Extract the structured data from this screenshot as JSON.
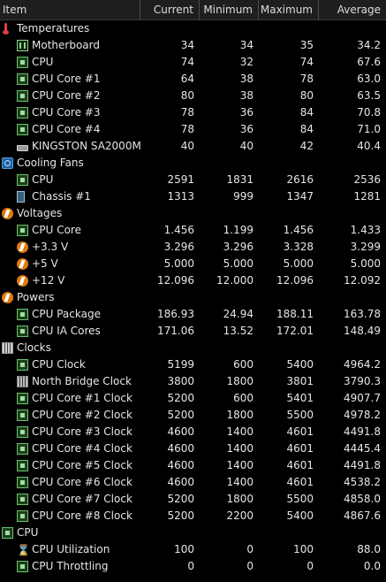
{
  "columns": [
    "Item",
    "Current",
    "Minimum",
    "Maximum",
    "Average"
  ],
  "rows": [
    {
      "type": "group",
      "label": "Temperatures",
      "icon": "thermometer-icon"
    },
    {
      "type": "item",
      "label": "Motherboard",
      "icon": "motherboard-icon",
      "current": "34",
      "min": "34",
      "max": "35",
      "avg": "34.2"
    },
    {
      "type": "item",
      "label": "CPU",
      "icon": "cpu-chip-icon",
      "current": "74",
      "min": "32",
      "max": "74",
      "avg": "67.6"
    },
    {
      "type": "item",
      "label": "CPU Core #1",
      "icon": "cpu-chip-icon",
      "current": "64",
      "min": "38",
      "max": "78",
      "avg": "63.0"
    },
    {
      "type": "item",
      "label": "CPU Core #2",
      "icon": "cpu-chip-icon",
      "current": "80",
      "min": "38",
      "max": "80",
      "avg": "63.5"
    },
    {
      "type": "item",
      "label": "CPU Core #3",
      "icon": "cpu-chip-icon",
      "current": "78",
      "min": "36",
      "max": "84",
      "avg": "70.8"
    },
    {
      "type": "item",
      "label": "CPU Core #4",
      "icon": "cpu-chip-icon",
      "current": "78",
      "min": "36",
      "max": "84",
      "avg": "71.0"
    },
    {
      "type": "item",
      "label": "KINGSTON SA2000M...",
      "icon": "disk-icon",
      "current": "40",
      "min": "40",
      "max": "42",
      "avg": "40.4"
    },
    {
      "type": "group",
      "label": "Cooling Fans",
      "icon": "fan-icon"
    },
    {
      "type": "item",
      "label": "CPU",
      "icon": "cpu-chip-icon",
      "current": "2591",
      "min": "1831",
      "max": "2616",
      "avg": "2536"
    },
    {
      "type": "item",
      "label": "Chassis #1",
      "icon": "chassis-icon",
      "current": "1313",
      "min": "999",
      "max": "1347",
      "avg": "1281"
    },
    {
      "type": "group",
      "label": "Voltages",
      "icon": "voltage-icon"
    },
    {
      "type": "item",
      "label": "CPU Core",
      "icon": "cpu-chip-icon",
      "current": "1.456",
      "min": "1.199",
      "max": "1.456",
      "avg": "1.433"
    },
    {
      "type": "item",
      "label": "+3.3 V",
      "icon": "voltage-icon",
      "current": "3.296",
      "min": "3.296",
      "max": "3.328",
      "avg": "3.299"
    },
    {
      "type": "item",
      "label": "+5 V",
      "icon": "voltage-icon",
      "current": "5.000",
      "min": "5.000",
      "max": "5.000",
      "avg": "5.000"
    },
    {
      "type": "item",
      "label": "+12 V",
      "icon": "voltage-icon",
      "current": "12.096",
      "min": "12.000",
      "max": "12.096",
      "avg": "12.092"
    },
    {
      "type": "group",
      "label": "Powers",
      "icon": "voltage-icon"
    },
    {
      "type": "item",
      "label": "CPU Package",
      "icon": "cpu-chip-icon",
      "current": "186.93",
      "min": "24.94",
      "max": "188.11",
      "avg": "163.78"
    },
    {
      "type": "item",
      "label": "CPU IA Cores",
      "icon": "cpu-chip-icon",
      "current": "171.06",
      "min": "13.52",
      "max": "172.01",
      "avg": "148.49"
    },
    {
      "type": "group",
      "label": "Clocks",
      "icon": "clock-chip-icon"
    },
    {
      "type": "item",
      "label": "CPU Clock",
      "icon": "cpu-chip-icon",
      "current": "5199",
      "min": "600",
      "max": "5400",
      "avg": "4964.2"
    },
    {
      "type": "item",
      "label": "North Bridge Clock",
      "icon": "northbridge-icon",
      "current": "3800",
      "min": "1800",
      "max": "3801",
      "avg": "3790.3"
    },
    {
      "type": "item",
      "label": "CPU Core #1 Clock",
      "icon": "cpu-chip-icon",
      "current": "5200",
      "min": "600",
      "max": "5401",
      "avg": "4907.7"
    },
    {
      "type": "item",
      "label": "CPU Core #2 Clock",
      "icon": "cpu-chip-icon",
      "current": "5200",
      "min": "1800",
      "max": "5500",
      "avg": "4978.2"
    },
    {
      "type": "item",
      "label": "CPU Core #3 Clock",
      "icon": "cpu-chip-icon",
      "current": "4600",
      "min": "1400",
      "max": "4601",
      "avg": "4491.8"
    },
    {
      "type": "item",
      "label": "CPU Core #4 Clock",
      "icon": "cpu-chip-icon",
      "current": "4600",
      "min": "1400",
      "max": "4601",
      "avg": "4445.4"
    },
    {
      "type": "item",
      "label": "CPU Core #5 Clock",
      "icon": "cpu-chip-icon",
      "current": "4600",
      "min": "1400",
      "max": "4601",
      "avg": "4491.8"
    },
    {
      "type": "item",
      "label": "CPU Core #6 Clock",
      "icon": "cpu-chip-icon",
      "current": "4600",
      "min": "1400",
      "max": "4601",
      "avg": "4538.2"
    },
    {
      "type": "item",
      "label": "CPU Core #7 Clock",
      "icon": "cpu-chip-icon",
      "current": "5200",
      "min": "1800",
      "max": "5500",
      "avg": "4858.0"
    },
    {
      "type": "item",
      "label": "CPU Core #8 Clock",
      "icon": "cpu-chip-icon",
      "current": "5200",
      "min": "2200",
      "max": "5400",
      "avg": "4867.6"
    },
    {
      "type": "group",
      "label": "CPU",
      "icon": "cpu-chip-icon"
    },
    {
      "type": "item",
      "label": "CPU Utilization",
      "icon": "hourglass-icon",
      "current": "100",
      "min": "0",
      "max": "100",
      "avg": "88.0"
    },
    {
      "type": "item",
      "label": "CPU Throttling",
      "icon": "cpu-chip-icon",
      "current": "0",
      "min": "0",
      "max": "0",
      "avg": "0.0"
    }
  ]
}
